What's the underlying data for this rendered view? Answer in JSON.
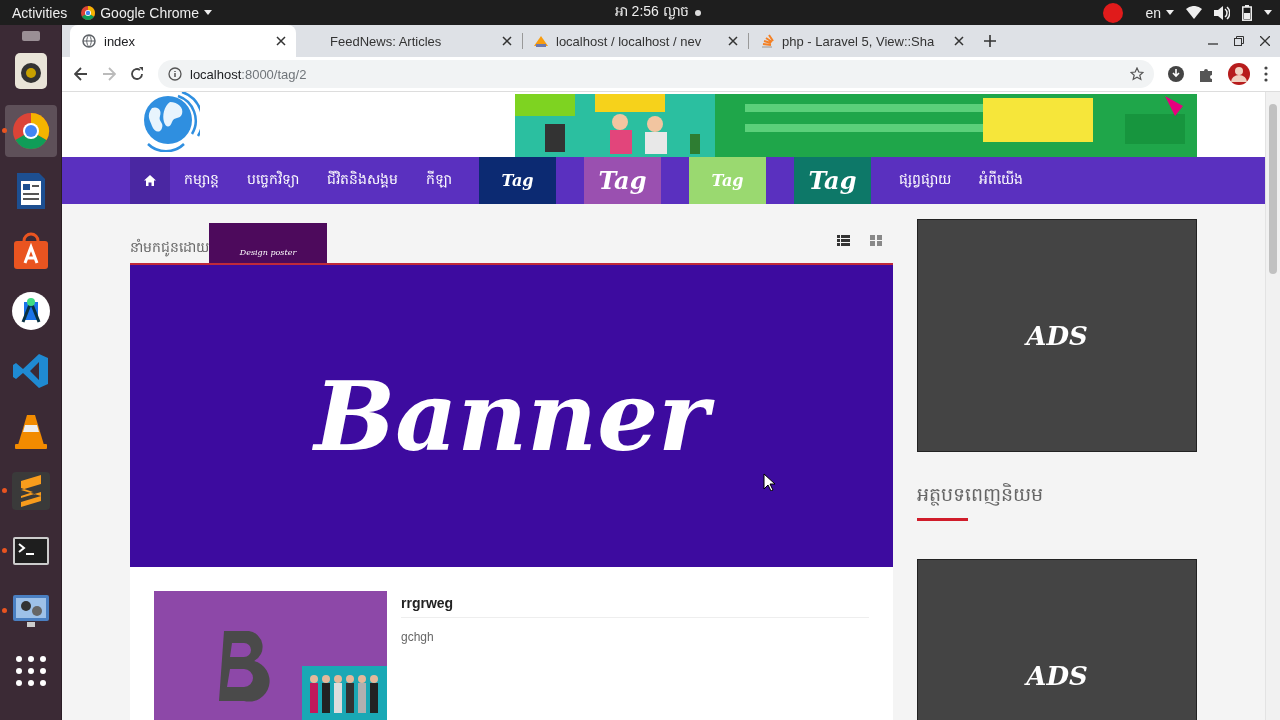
{
  "top_bar": {
    "activities": "Activities",
    "app": "Google Chrome",
    "clock": "អា  2:56 ល្ងាច",
    "language": "en"
  },
  "dock": {
    "items": [
      {
        "kind": "speaker",
        "running": false,
        "selected": false
      },
      {
        "kind": "chrome",
        "running": true,
        "selected": true
      },
      {
        "kind": "writer",
        "running": false,
        "selected": false
      },
      {
        "kind": "store",
        "running": false,
        "selected": false
      },
      {
        "kind": "studio",
        "running": false,
        "selected": false
      },
      {
        "kind": "vscode",
        "running": false,
        "selected": false
      },
      {
        "kind": "vlc",
        "running": false,
        "selected": false
      },
      {
        "kind": "sublime",
        "running": true,
        "selected": false
      },
      {
        "kind": "terminal",
        "running": true,
        "selected": false
      },
      {
        "kind": "media",
        "running": true,
        "selected": false
      },
      {
        "kind": "apps",
        "running": false,
        "selected": false
      }
    ]
  },
  "browser": {
    "tabs": [
      {
        "title": "index",
        "selected": true,
        "kind": "globe"
      },
      {
        "title": "FeedNews: Articles",
        "selected": false,
        "kind": "blank"
      },
      {
        "title": "localhost / localhost / nev",
        "selected": false,
        "kind": "pma"
      },
      {
        "title": "php - Laravel 5, View::Sha",
        "selected": false,
        "kind": "stack"
      }
    ],
    "url_host": "localhost",
    "url_path": ":8000/tag/2"
  },
  "site": {
    "nav": [
      {
        "kind": "home",
        "selected": true
      },
      {
        "kind": "link",
        "label": "កម្សាន្ត"
      },
      {
        "kind": "link",
        "label": "បច្ចេកវិទ្យា"
      },
      {
        "kind": "link",
        "label": "ជីវិតនិងសង្គម"
      },
      {
        "kind": "link",
        "label": "កីឡា"
      },
      {
        "kind": "tag",
        "label": "Tag",
        "color": "#0c2a72",
        "large": false
      },
      {
        "kind": "tag",
        "label": "Tag",
        "color": "#9a50b0",
        "large": true
      },
      {
        "kind": "tag",
        "label": "Tag",
        "color": "#9ad970",
        "large": false
      },
      {
        "kind": "tag",
        "label": "Tag",
        "color": "#0d7868",
        "large": true
      },
      {
        "kind": "link",
        "label": "ផ្សព្វផ្សាយ"
      },
      {
        "kind": "link",
        "label": "អំពីយើង"
      }
    ],
    "sponsor": {
      "label": "នាំមកជូនដោយ",
      "poster": "Design poster"
    },
    "view_buttons": [
      {
        "kind": "list",
        "selected": true
      },
      {
        "kind": "grid",
        "selected": false
      }
    ],
    "banner": "Banner",
    "articles": [
      {
        "title": "rrgrweg",
        "excerpt": "gchgh"
      }
    ],
    "sidebar": {
      "ads": [
        "ADS",
        "ADS"
      ],
      "popular_heading": "អត្ថបទពេញនិយម"
    }
  }
}
